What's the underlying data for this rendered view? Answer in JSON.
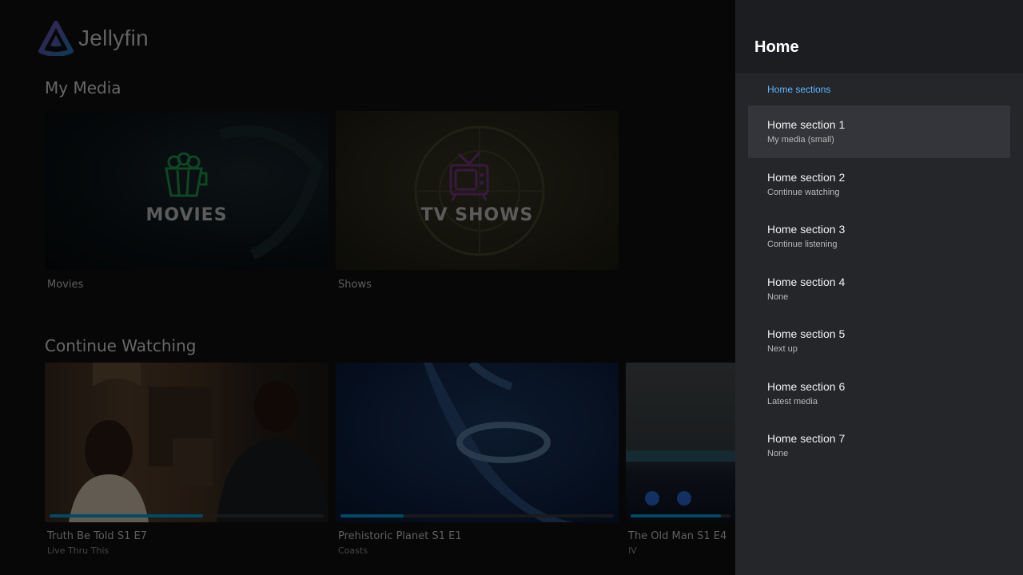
{
  "app": {
    "logo_text": "Jellyfin"
  },
  "rows": {
    "my_media": {
      "title": "My Media",
      "items": [
        {
          "card_text": "MOVIES",
          "label": "Movies",
          "icon": "popcorn-icon"
        },
        {
          "card_text": "TV SHOWS",
          "label": "Shows",
          "icon": "tv-icon"
        }
      ]
    },
    "continue_watching": {
      "title": "Continue Watching",
      "items": [
        {
          "title": "Truth Be Told S1 E7",
          "subtitle": "Live Thru This",
          "progress": 0.56
        },
        {
          "title": "Prehistoric Planet S1 E1",
          "subtitle": "Coasts",
          "progress": 0.23
        },
        {
          "title": "The Old Man S1 E4",
          "subtitle": "IV",
          "progress": 0.9
        }
      ]
    }
  },
  "panel": {
    "title": "Home",
    "section_label": "Home sections",
    "items": [
      {
        "title": "Home section 1",
        "value": "My media (small)"
      },
      {
        "title": "Home section 2",
        "value": "Continue watching"
      },
      {
        "title": "Home section 3",
        "value": "Continue listening"
      },
      {
        "title": "Home section 4",
        "value": "None"
      },
      {
        "title": "Home section 5",
        "value": "Next up"
      },
      {
        "title": "Home section 6",
        "value": "Latest media"
      },
      {
        "title": "Home section 7",
        "value": "None"
      }
    ]
  },
  "colors": {
    "accent": "#00a4dc",
    "panel_section_label": "#5fb6ff",
    "movies_icon": "#1f9e4f",
    "tv_icon": "#7b3a88"
  }
}
